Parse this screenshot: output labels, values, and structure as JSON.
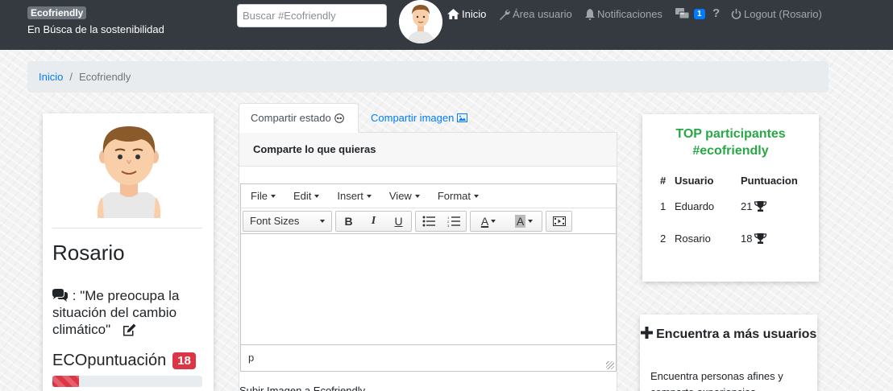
{
  "navbar": {
    "brand": "Ecofriendly",
    "tagline": "En Búsca de la sostenibilidad",
    "search_placeholder": "Buscar #Ecofriendly",
    "links": {
      "home": "Inicio",
      "user_area": "Área usuario",
      "notifications": "Notificaciones",
      "messages_count": "1",
      "help": "?",
      "logout": "Logout (Rosario)"
    }
  },
  "breadcrumb": {
    "home": "Inicio",
    "separator": "/",
    "current": "Ecofriendly"
  },
  "profile": {
    "name": "Rosario",
    "status_prefix": ": ",
    "status": "\"Me preocupa la situación del cambio climático\"",
    "eco_label": "ECOpuntuación",
    "eco_score": "18",
    "progress_percent": 18
  },
  "share": {
    "tabs": {
      "status": "Compartir estado",
      "image": "Compartir imagen"
    },
    "header": "Comparte lo que quieras",
    "editor": {
      "menus": [
        "File",
        "Edit",
        "Insert",
        "View",
        "Format"
      ],
      "font_sizes": "Font Sizes",
      "bold": "B",
      "italic": "I",
      "underline": "U",
      "text_color": "A",
      "bg_color": "A",
      "status_path": "p"
    },
    "upload_label": "Subir Imagen a Ecofriendly"
  },
  "ranking": {
    "title_line1": "TOP participantes",
    "title_line2": "#ecofriendly",
    "headers": {
      "rank": "#",
      "user": "Usuario",
      "score": "Puntuacion"
    },
    "rows": [
      {
        "rank": "1",
        "user": "Eduardo",
        "score": "21"
      },
      {
        "rank": "2",
        "user": "Rosario",
        "score": "18"
      }
    ]
  },
  "find_users": {
    "title_icon": "plus-icon",
    "title": "Encuentra a más usuarios",
    "text": "Encuentra personas afines y comparte experiencias"
  }
}
